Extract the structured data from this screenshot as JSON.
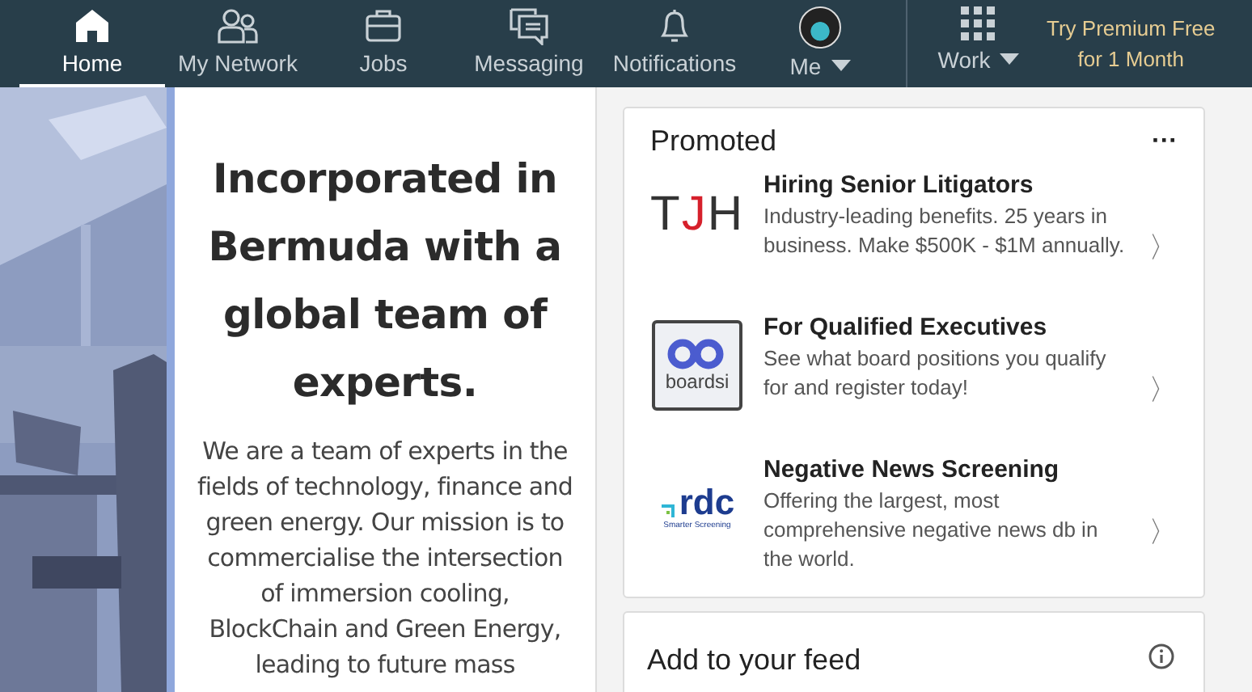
{
  "nav": {
    "items": [
      {
        "kind": "home",
        "label": "Home",
        "selected": true,
        "caret": false
      },
      {
        "kind": "network",
        "label": "My Network",
        "selected": false,
        "caret": false
      },
      {
        "kind": "jobs",
        "label": "Jobs",
        "selected": false,
        "caret": false
      },
      {
        "kind": "messaging",
        "label": "Messaging",
        "selected": false,
        "caret": false
      },
      {
        "kind": "notifications",
        "label": "Notifications",
        "selected": false,
        "caret": false
      },
      {
        "kind": "me",
        "label": "Me",
        "selected": false,
        "caret": true
      }
    ],
    "work": {
      "label": "Work",
      "caret": true
    },
    "premium": [
      "Try Premium Free",
      "for 1 Month"
    ]
  },
  "post": {
    "headline": "Incorporated in Bermuda with a global team of experts.",
    "body": "We are a team of experts in the fields of technology, finance and green energy. Our mission is to commercialise the intersection of immersion cooling, BlockChain and Green Energy, leading to future mass"
  },
  "promoted": {
    "title": "Promoted",
    "menu": "···",
    "ads": [
      {
        "kind": "tjh",
        "logo_text": [
          "T",
          "J",
          "H"
        ],
        "title": "Hiring Senior Litigators",
        "text": "Industry-leading benefits. 25 years in business. Make $500K - $1M annually.",
        "chevron": "〉"
      },
      {
        "kind": "boardsi",
        "logo_text": [
          "boardsi"
        ],
        "title": "For Qualified Executives",
        "text": "See what board positions you qualify for and register today!",
        "chevron": "〉"
      },
      {
        "kind": "rdc",
        "logo_text": [
          "rdc",
          "Smarter Screening"
        ],
        "title": "Negative News Screening",
        "text": "Offering the largest, most comprehensive negative news db in the world.",
        "chevron": "〉"
      }
    ]
  },
  "feed": {
    "title": "Add to your feed"
  }
}
